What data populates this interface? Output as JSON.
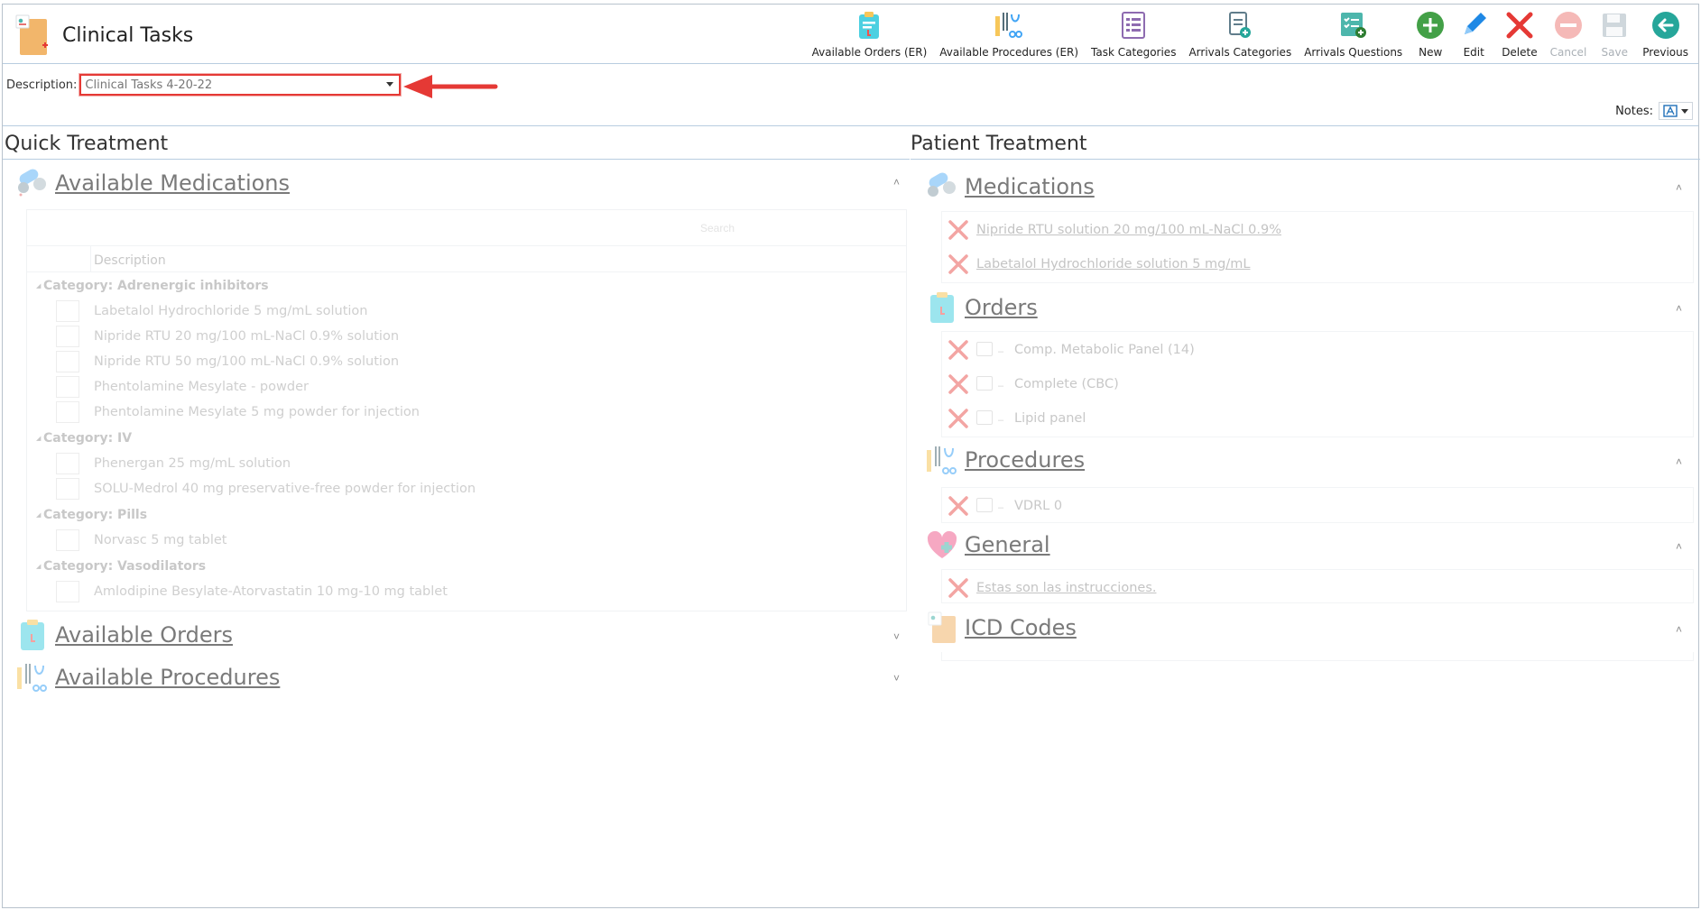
{
  "header": {
    "title": "Clinical Tasks",
    "app_icon": "clinical-tasks-icon"
  },
  "toolbar": {
    "buttons": [
      {
        "label": "Available Orders (ER)",
        "icon": "clipboard-icon",
        "enabled": true
      },
      {
        "label": "Available Procedures (ER)",
        "icon": "procedure-instruments-icon",
        "enabled": true
      },
      {
        "label": "Task Categories",
        "icon": "list-document-icon",
        "enabled": true
      },
      {
        "label": "Arrivals Categories",
        "icon": "add-document-icon",
        "enabled": true
      },
      {
        "label": "Arrivals Questions",
        "icon": "checklist-add-icon",
        "enabled": true
      },
      {
        "label": "New",
        "icon": "plus-circle-icon",
        "enabled": true
      },
      {
        "label": "Edit",
        "icon": "pencil-icon",
        "enabled": true
      },
      {
        "label": "Delete",
        "icon": "x-icon",
        "enabled": true
      },
      {
        "label": "Cancel",
        "icon": "minus-circle-icon",
        "enabled": false
      },
      {
        "label": "Save",
        "icon": "floppy-disk-icon",
        "enabled": false
      },
      {
        "label": "Previous",
        "icon": "arrow-left-circle-icon",
        "enabled": true
      }
    ]
  },
  "description": {
    "label": "Description:",
    "value": "Clinical Tasks 4-20-22"
  },
  "notes": {
    "label": "Notes:"
  },
  "quick_treatment": {
    "title": "Quick Treatment",
    "available_medications": {
      "title": "Available Medications",
      "search_placeholder": "Search",
      "column_header": "Description",
      "categories": [
        {
          "name": "Category: Adrenergic inhibitors",
          "items": [
            "Labetalol Hydrochloride 5 mg/mL solution",
            "Nipride RTU 20 mg/100 mL-NaCl 0.9% solution",
            "Nipride RTU 50 mg/100 mL-NaCl 0.9% solution",
            "Phentolamine Mesylate - powder",
            "Phentolamine Mesylate 5 mg powder for injection"
          ]
        },
        {
          "name": "Category: IV",
          "items": [
            "Phenergan 25 mg/mL solution",
            "SOLU-Medrol 40 mg preservative-free powder for injection"
          ]
        },
        {
          "name": "Category: Pills",
          "items": [
            "Norvasc 5 mg tablet"
          ]
        },
        {
          "name": "Category: Vasodilators",
          "items": [
            "Amlodipine Besylate-Atorvastatin 10 mg-10 mg tablet"
          ]
        }
      ]
    },
    "available_orders": {
      "title": "Available Orders"
    },
    "available_procedures": {
      "title": "Available Procedures"
    }
  },
  "patient_treatment": {
    "title": "Patient Treatment",
    "medications": {
      "title": "Medications",
      "items": [
        "Nipride RTU solution 20 mg/100 mL-NaCl 0.9%",
        "Labetalol Hydrochloride solution 5 mg/mL"
      ]
    },
    "orders": {
      "title": "Orders",
      "items": [
        "Comp. Metabolic Panel (14)",
        "Complete (CBC)",
        "Lipid panel"
      ]
    },
    "procedures": {
      "title": "Procedures",
      "items": [
        "VDRL 0"
      ]
    },
    "general": {
      "title": "General",
      "items": [
        "Estas son las instrucciones."
      ]
    },
    "icd_codes": {
      "title": "ICD Codes"
    }
  },
  "colors": {
    "accent_red": "#e53935",
    "new_green": "#43a047",
    "edit_blue": "#1e88e5",
    "previous_teal": "#26a69a",
    "divider": "#b8cde0"
  }
}
